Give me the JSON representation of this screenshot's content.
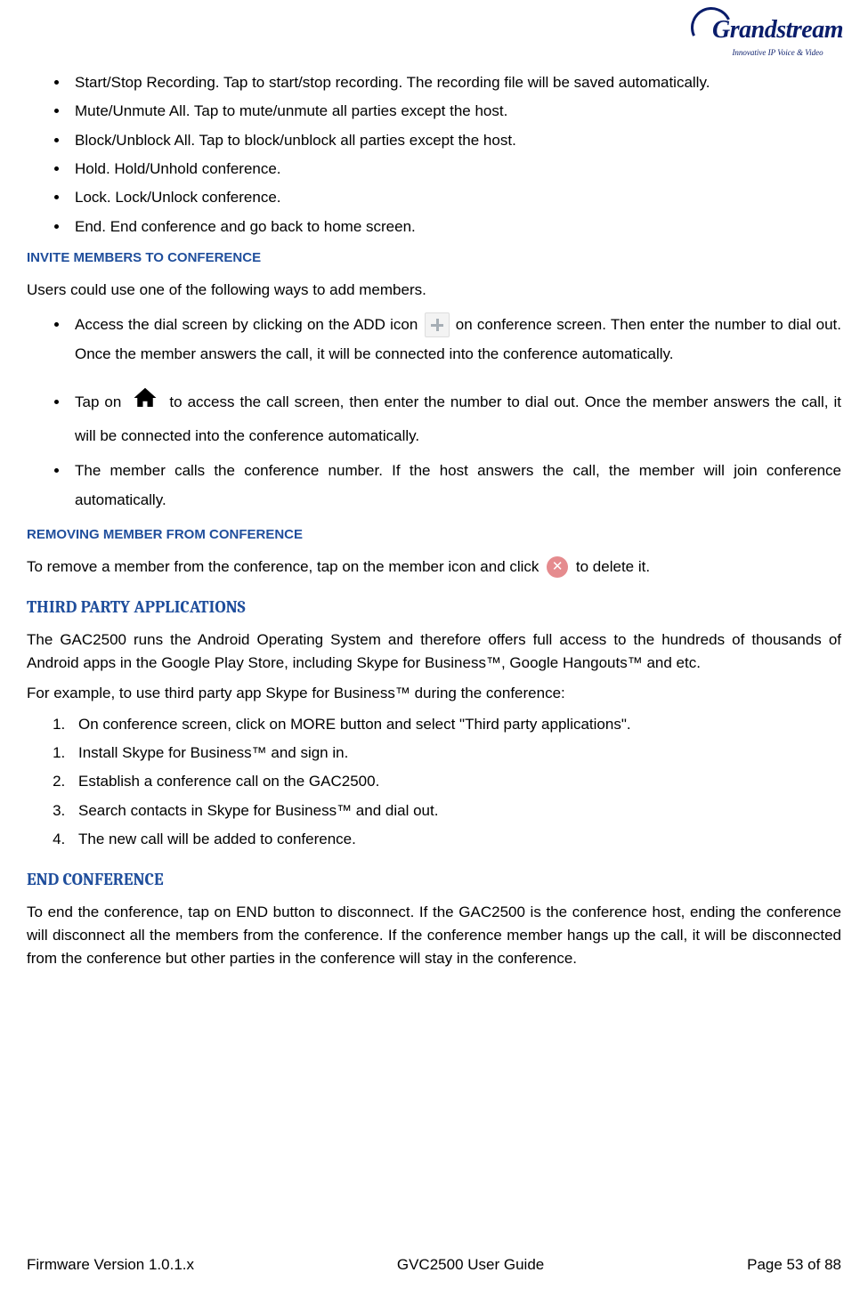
{
  "logo": {
    "brand": "Grandstream",
    "tag": "Innovative IP Voice & Video"
  },
  "bullets_top": [
    "Start/Stop Recording. Tap to start/stop recording. The recording file will be saved automatically.",
    "Mute/Unmute All. Tap to mute/unmute all parties except the host.",
    "Block/Unblock All. Tap to block/unblock all parties except the host.",
    "Hold. Hold/Unhold conference.",
    "Lock. Lock/Unlock conference.",
    "End. End conference and go back to home screen."
  ],
  "h_invite": "INVITE MEMBERS TO CONFERENCE",
  "invite_intro": "Users could use one of the following ways to add members.",
  "invite_item1_a": "Access the dial screen by clicking on the ADD icon ",
  "invite_item1_b": "on conference screen. Then enter the number to dial out. Once the member answers the call, it will be connected into the conference automatically.",
  "invite_item2_a": "Tap on ",
  "invite_item2_b": " to access the call screen, then enter the number to dial out. Once the member answers the call, it will be connected into the conference automatically.",
  "invite_item3": "The member calls the conference number. If the host answers the call, the member will join conference automatically.",
  "h_remove": "REMOVING MEMBER FROM CONFERENCE",
  "remove_a": "To remove a member from the conference, tap on the member icon and click ",
  "remove_b": " to delete it.",
  "h_third": "THIRD PARTY APPLICATIONS",
  "third_p1": "The GAC2500 runs the Android Operating System and therefore offers full access to the hundreds of thousands of Android apps in the Google Play Store, including Skype for Business™, Google Hangouts™ and etc.",
  "third_p2": "For example, to use third party app Skype for Business™ during the conference:",
  "third_steps": [
    "On conference screen, click on MORE button and select \"Third party applications\".",
    "Install Skype for Business™ and sign in.",
    "Establish a conference call on the GAC2500.",
    "Search contacts in Skype for Business™ and dial out.",
    "The new call will be added to conference."
  ],
  "h_end": "END CONFERENCE",
  "end_p": "To end the conference, tap on END button to disconnect. If the GAC2500 is the conference host, ending the conference will disconnect all the members from the conference. If the conference member hangs up the call, it will be disconnected from the conference but other parties in the conference will stay in the conference.",
  "footer": {
    "left": "Firmware Version 1.0.1.x",
    "center": "GVC2500 User Guide",
    "right": "Page 53 of 88"
  }
}
